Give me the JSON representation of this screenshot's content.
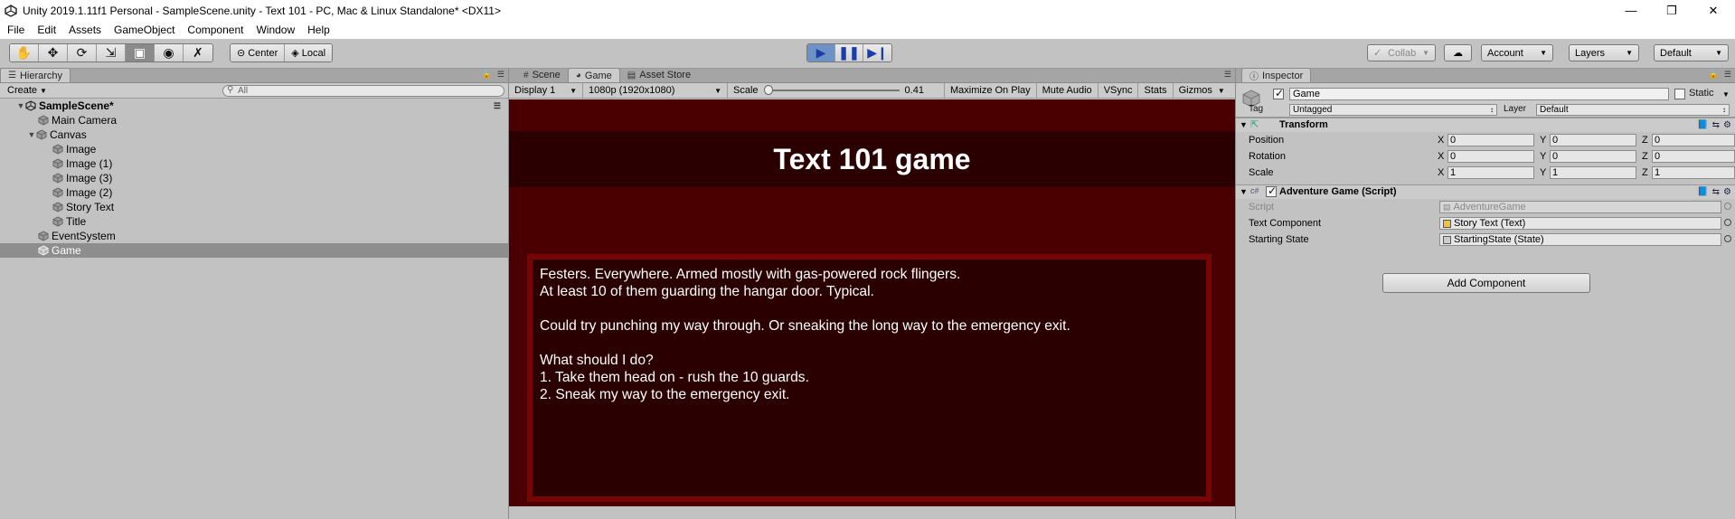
{
  "window": {
    "title": "Unity 2019.1.11f1 Personal - SampleScene.unity - Text 101 - PC, Mac & Linux Standalone* <DX11>"
  },
  "menu": [
    "File",
    "Edit",
    "Assets",
    "GameObject",
    "Component",
    "Window",
    "Help"
  ],
  "toolbar": {
    "pivot_center": "Center",
    "pivot_local": "Local",
    "collab": "Collab",
    "account": "Account",
    "layers": "Layers",
    "layout": "Default"
  },
  "hierarchy": {
    "tab": "Hierarchy",
    "create": "Create",
    "search_placeholder": "All",
    "scene": "SampleScene*",
    "items": [
      "Main Camera",
      "Canvas",
      "Image",
      "Image (1)",
      "Image (3)",
      "Image (2)",
      "Story Text",
      "Title",
      "EventSystem",
      "Game"
    ],
    "selected": "Game"
  },
  "center_tabs": [
    "Scene",
    "Game",
    "Asset Store"
  ],
  "game_toolbar": {
    "display": "Display 1",
    "resolution": "1080p (1920x1080)",
    "scale_label": "Scale",
    "scale_value": "0.41",
    "scale_fraction": 0.0,
    "maximize": "Maximize On Play",
    "mute": "Mute Audio",
    "vsync": "VSync",
    "stats": "Stats",
    "gizmos": "Gizmos"
  },
  "game": {
    "title": "Text 101 game",
    "story": "Festers. Everywhere. Armed mostly with gas-powered rock flingers.\nAt least 10 of them guarding the hangar door. Typical.\n\nCould try punching my way through. Or sneaking the long way to the emergency exit.\n\nWhat should I do?\n1. Take them head on - rush the 10 guards.\n2. Sneak my way to the emergency exit."
  },
  "inspector": {
    "tab": "Inspector",
    "object_name": "Game",
    "static_label": "Static",
    "tag_label": "Tag",
    "tag_value": "Untagged",
    "layer_label": "Layer",
    "layer_value": "Default",
    "transform": {
      "title": "Transform",
      "position_label": "Position",
      "rotation_label": "Rotation",
      "scale_label": "Scale",
      "position": [
        "0",
        "0",
        "0"
      ],
      "rotation": [
        "0",
        "0",
        "0"
      ],
      "scale": [
        "1",
        "1",
        "1"
      ],
      "axis_x": "X",
      "axis_y": "Y",
      "axis_z": "Z"
    },
    "script_component": {
      "title": "Adventure Game (Script)",
      "script_label": "Script",
      "script_value": "AdventureGame",
      "text_component_label": "Text Component",
      "text_component_value": "Story Text (Text)",
      "starting_state_label": "Starting State",
      "starting_state_value": "StartingState (State)"
    },
    "add_component": "Add Component"
  }
}
